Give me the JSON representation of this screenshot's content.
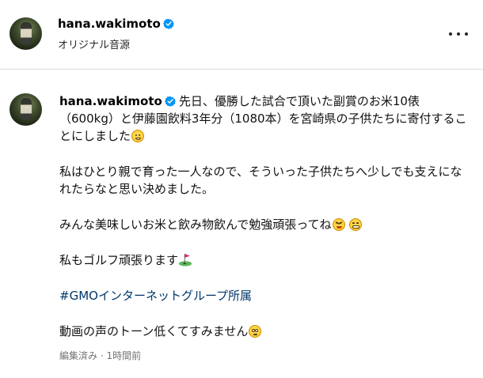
{
  "header": {
    "username": "hana.wakimoto",
    "subtitle": "オリジナル音源"
  },
  "caption": {
    "username": "hana.wakimoto",
    "line1": "先日、優勝した試合で頂いた副賞のお米10俵（600kg）と伊藤園飲料3年分（1080本）を宮崎県の子供たちに寄付することにしました",
    "para2": "私はひとり親で育った一人なので、そういった子供たちへ少しでも支えになれたらなと思い決めました。",
    "para3": "みんな美味しいお米と飲み物飲んで勉強頑張ってね",
    "para4": "私もゴルフ頑張ります",
    "hashtag": "#GMOインターネットグループ所属",
    "para5": "動画の声のトーン低くてすみません"
  },
  "meta": {
    "edited": "編集済み",
    "separator": "·",
    "time": "1時間前"
  },
  "colors": {
    "verified": "#0095f6",
    "hashtag": "#00376b",
    "divider": "#dbdbdb",
    "meta": "#737373"
  },
  "icons": [
    "verified-badge-icon",
    "more-options-icon",
    "smiling-face-emoji",
    "squinting-face-emoji",
    "grinning-face-emoji",
    "golf-flag-emoji",
    "eye-roll-face-emoji"
  ]
}
